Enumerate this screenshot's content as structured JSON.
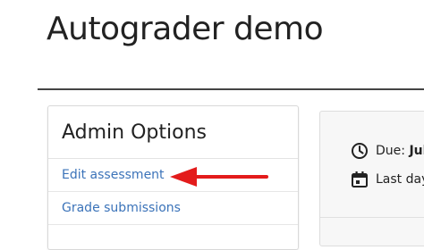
{
  "page": {
    "title": "Autograder demo"
  },
  "admin_options": {
    "title": "Admin Options",
    "links": [
      {
        "label": "Edit assessment"
      },
      {
        "label": "Grade submissions"
      }
    ]
  },
  "annotation": {
    "arrow_color": "#e31b1b",
    "icon": "left-arrow-icon"
  },
  "info_panel": {
    "due_label": "Due:",
    "due_value": "Jul",
    "due_icon": "clock-icon",
    "last_day_label": "Last day",
    "last_day_icon": "calendar-icon"
  },
  "colors": {
    "link": "#3b73b9",
    "annotation": "#e31b1b"
  }
}
